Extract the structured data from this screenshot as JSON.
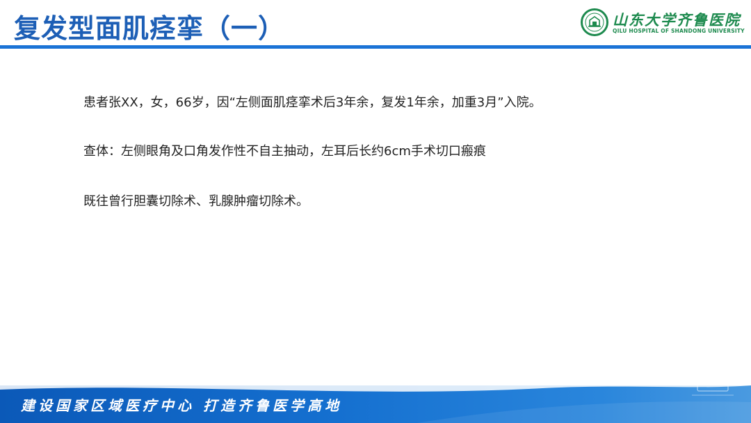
{
  "header": {
    "title": "复发型面肌痉挛（一）",
    "logo": {
      "name_cn": "山东大学齐鲁医院",
      "name_en": "QILU HOSPITAL OF SHANDONG UNIVERSITY",
      "color": "#1d8a4e"
    }
  },
  "body": {
    "paragraphs": [
      "患者张XX，女，66岁，因“左侧面肌痉挛术后3年余，复发1年余，加重3月”入院。",
      "查体：左侧眼角及口角发作性不自主抽动，左耳后长约6cm手术切口瘢痕",
      "既往曾行胆囊切除术、乳腺肿瘤切除术。"
    ]
  },
  "footer": {
    "slogan": "建设国家区域医疗中心  打造齐鲁医学高地"
  },
  "colors": {
    "title": "#1d5fb6",
    "accent_bar": "#1a73d6",
    "footer_bar": "#0b59b8",
    "text": "#222222"
  }
}
